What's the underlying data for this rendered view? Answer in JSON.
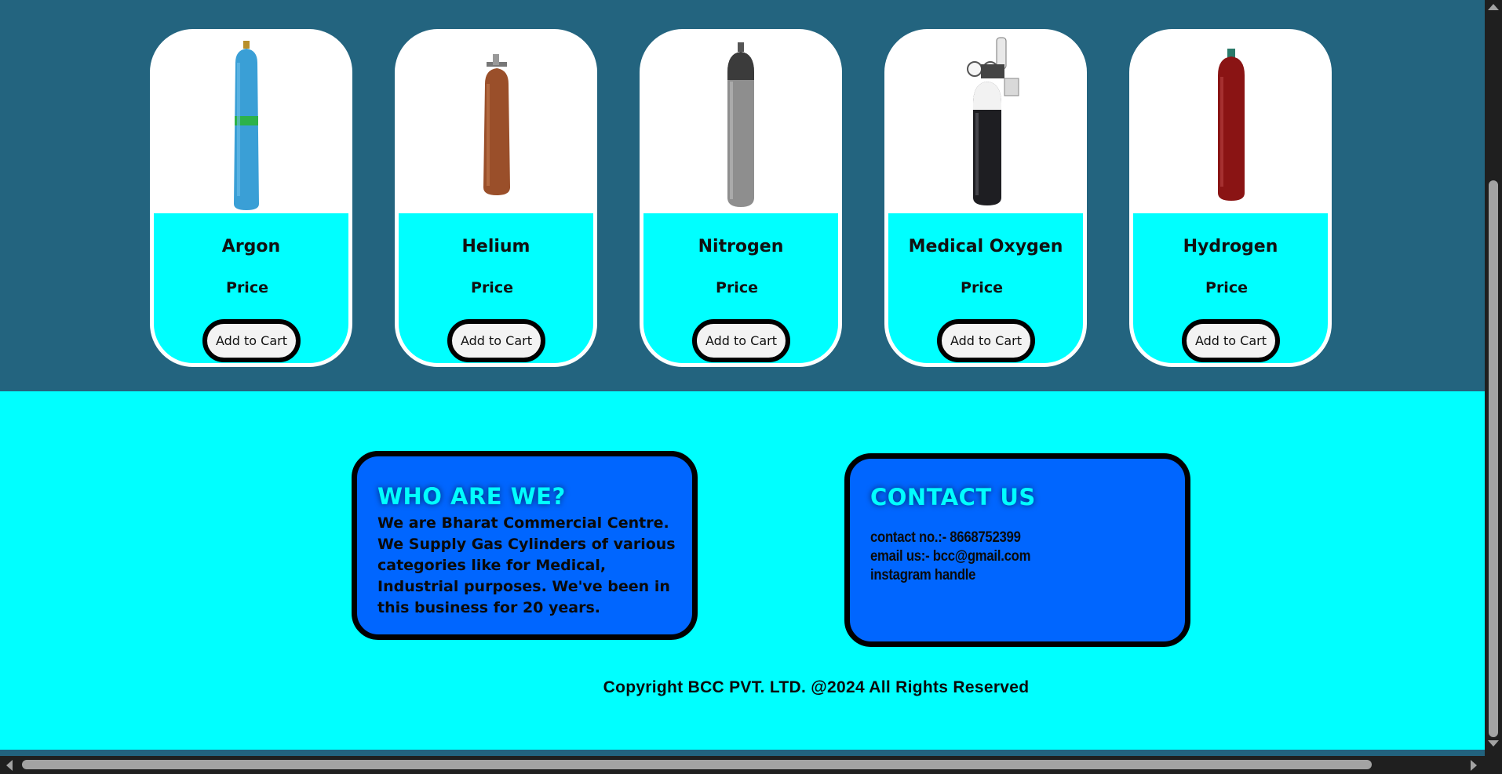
{
  "products": [
    {
      "name": "Argon",
      "price_label": "Price",
      "button_label": "Add to Cart",
      "image_icon": "argon-cylinder-icon",
      "colors": {
        "body": "#3ba0d6",
        "band": "#28b44a"
      }
    },
    {
      "name": "Helium",
      "price_label": "Price",
      "button_label": "Add to Cart",
      "image_icon": "helium-cylinder-icon",
      "colors": {
        "body": "#9a4f2a"
      }
    },
    {
      "name": "Nitrogen",
      "price_label": "Price",
      "button_label": "Add to Cart",
      "image_icon": "nitrogen-cylinder-icon",
      "colors": {
        "body": "#8e8e8e"
      }
    },
    {
      "name": "Medical Oxygen",
      "price_label": "Price",
      "button_label": "Add to Cart",
      "image_icon": "oxygen-cylinder-icon",
      "colors": {
        "body": "#1e1e22",
        "shoulder": "#f2f2f2"
      }
    },
    {
      "name": "Hydrogen",
      "price_label": "Price",
      "button_label": "Add to Cart",
      "image_icon": "hydrogen-cylinder-icon",
      "colors": {
        "body": "#8a1414"
      }
    }
  ],
  "footer": {
    "who": {
      "title": "WHO ARE WE?",
      "text": "We are Bharat Commercial Centre. We Supply Gas Cylinders of various categories like for Medical, Industrial purposes. We've been in this business for 20 years."
    },
    "contact": {
      "title": "CONTACT US",
      "phone": "contact no.:- 8668752399",
      "email": "email us:- bcc@gmail.com",
      "instagram": "instagram handle"
    },
    "copyright": "Copyright BCC PVT. LTD. @2024 All Rights Reserved"
  },
  "colors": {
    "header_bg": "#23647f",
    "accent_cyan": "#00ffff",
    "box_blue": "#0066ff"
  }
}
